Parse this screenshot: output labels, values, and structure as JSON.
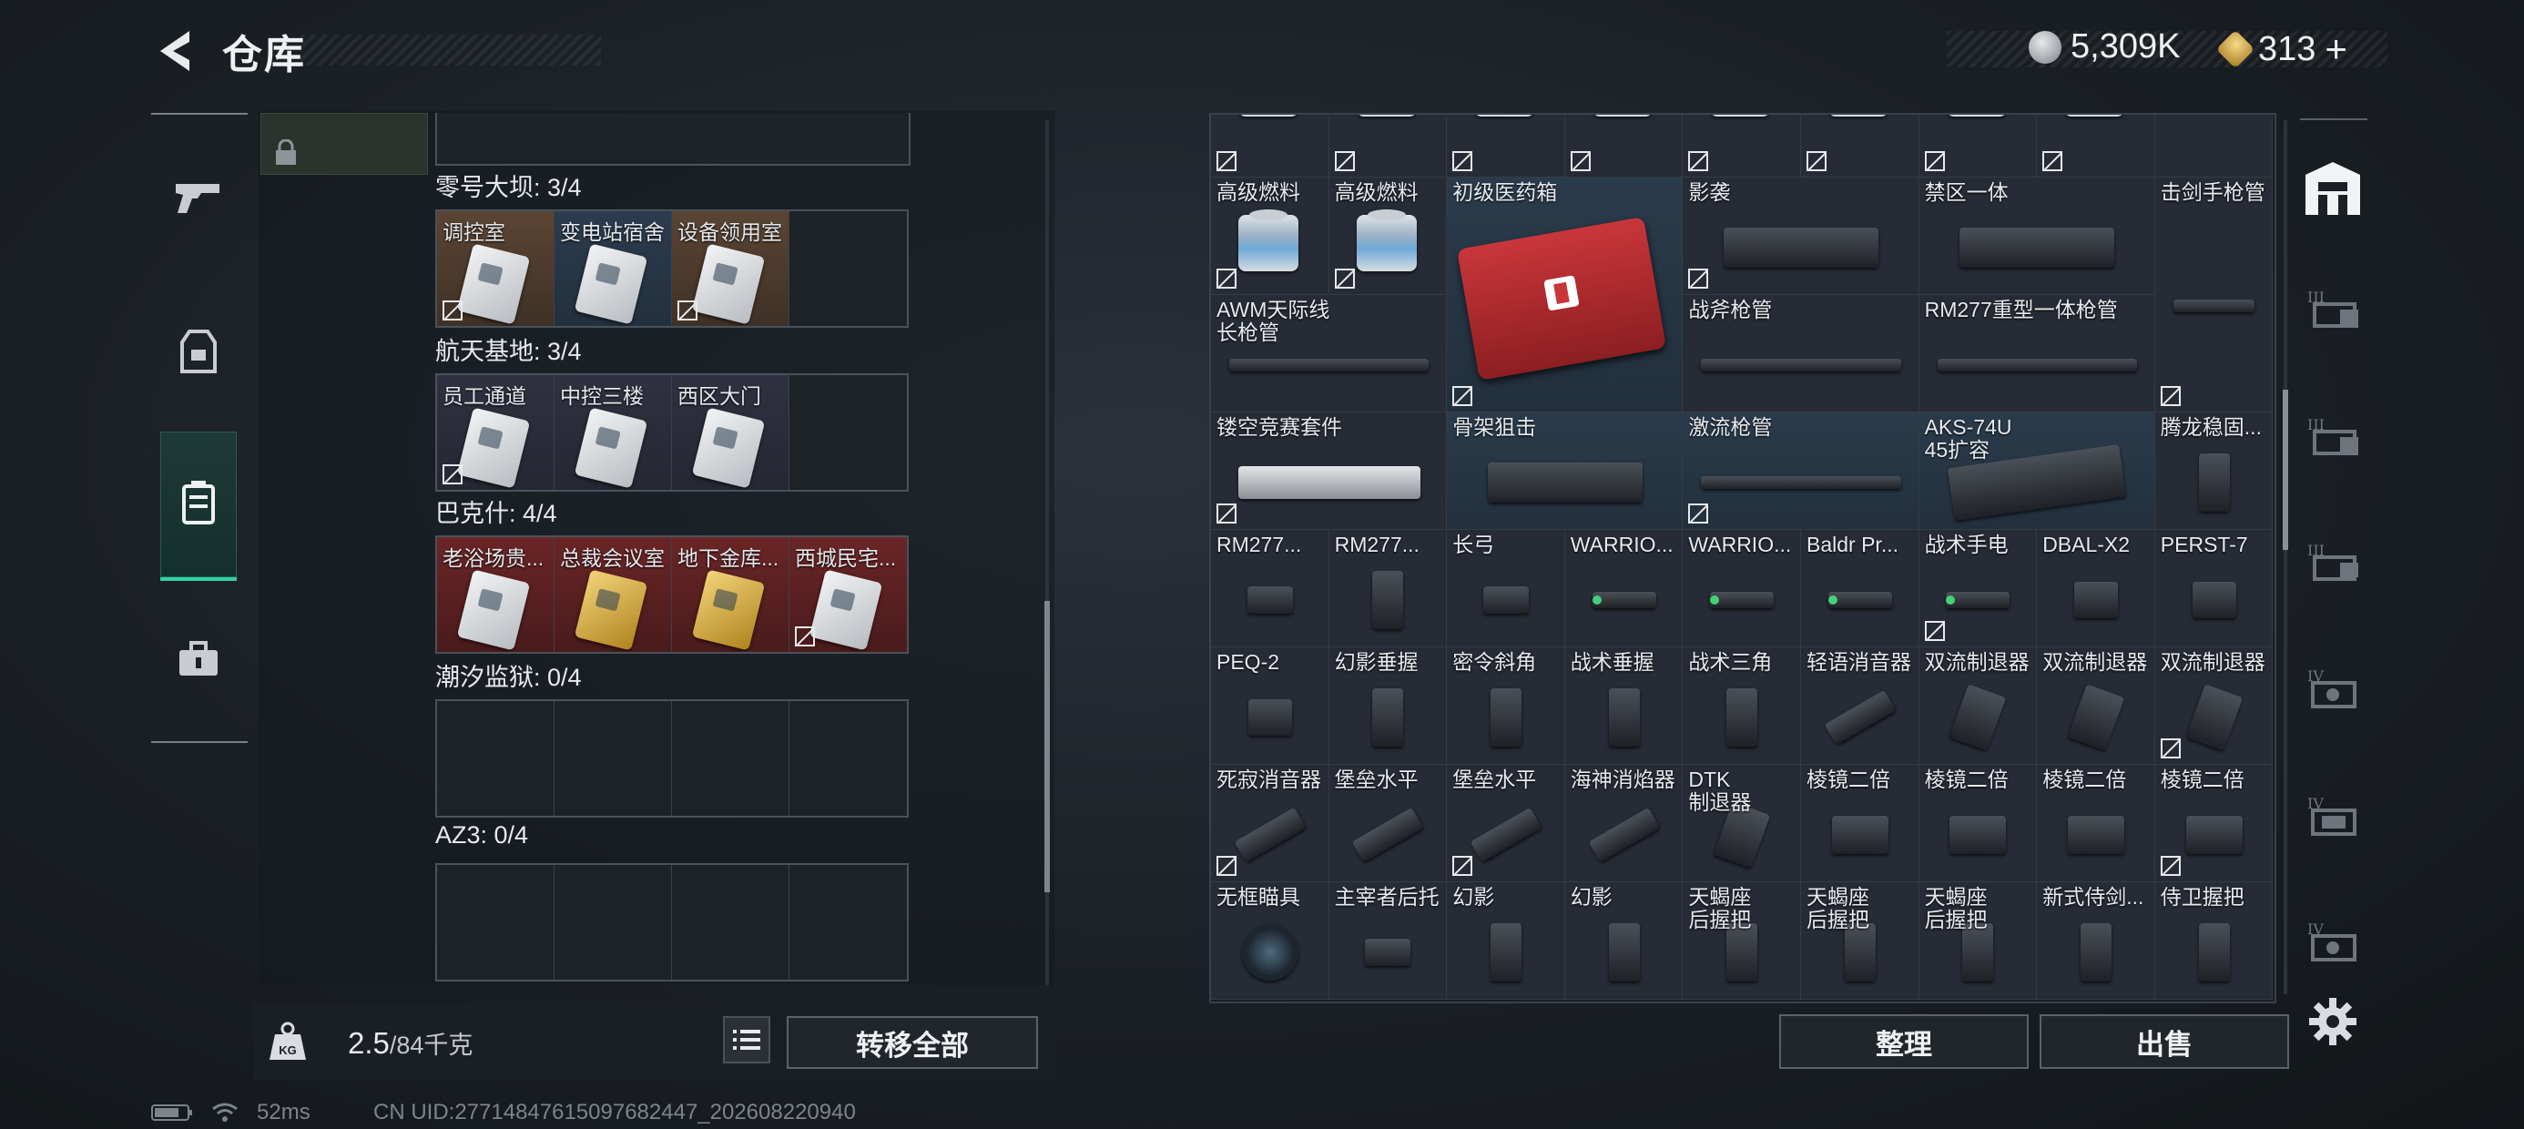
{
  "header": {
    "title": "仓库"
  },
  "currency": {
    "coins": "5,309K",
    "tickets": "313",
    "plus": "+"
  },
  "left": {
    "groups": [
      {
        "title": "零号大坝: 3/4",
        "cards": [
          {
            "label": "调控室",
            "bg": "brown",
            "kind": "silver",
            "unbound": true
          },
          {
            "label": "变电站宿舍",
            "bg": "blue",
            "kind": "silver",
            "unbound": false
          },
          {
            "label": "设备领用室",
            "bg": "brown",
            "kind": "silver",
            "unbound": true
          },
          {
            "label": "",
            "bg": "empty",
            "kind": "",
            "unbound": false
          }
        ]
      },
      {
        "title": "航天基地: 3/4",
        "cards": [
          {
            "label": "员工通道",
            "bg": "purple",
            "kind": "silver",
            "unbound": true
          },
          {
            "label": "中控三楼",
            "bg": "purple",
            "kind": "silver",
            "unbound": false
          },
          {
            "label": "西区大门",
            "bg": "purple",
            "kind": "silver",
            "unbound": false
          },
          {
            "label": "",
            "bg": "empty",
            "kind": "",
            "unbound": false
          }
        ]
      },
      {
        "title": "巴克什: 4/4",
        "cards": [
          {
            "label": "老浴场贵...",
            "bg": "red",
            "kind": "silver",
            "unbound": false
          },
          {
            "label": "总裁会议室",
            "bg": "red",
            "kind": "gold",
            "unbound": false
          },
          {
            "label": "地下金库...",
            "bg": "red",
            "kind": "gold",
            "unbound": false
          },
          {
            "label": "西城民宅...",
            "bg": "red",
            "kind": "silver",
            "unbound": true
          }
        ]
      },
      {
        "title": "潮汐监狱: 0/4",
        "cards": []
      },
      {
        "title": "AZ3: 0/4",
        "cards": []
      }
    ]
  },
  "weight": {
    "current": "2.5",
    "max": "/84千克"
  },
  "buttons": {
    "transfer_all": "转移全部",
    "sort": "整理",
    "sell": "出售"
  },
  "stash": {
    "top_row": [
      {
        "unbound": true
      },
      {
        "unbound": true
      },
      {
        "unbound": true
      },
      {
        "unbound": true
      },
      {
        "unbound": true
      },
      {
        "unbound": true
      },
      {
        "unbound": true
      },
      {
        "unbound": true
      },
      {
        "unbound": false
      }
    ],
    "items": [
      {
        "label": "高级燃料",
        "icon": "fuel",
        "unbound": true
      },
      {
        "label": "高级燃料",
        "icon": "fuel",
        "unbound": true
      },
      {
        "label": "初级医药箱",
        "icon": "medkit",
        "unbound": true
      },
      {
        "label": "影袭",
        "icon": "stock",
        "unbound": true
      },
      {
        "label": "禁区一体",
        "icon": "stock",
        "unbound": false
      },
      {
        "label": "击剑手枪管",
        "icon": "barrel",
        "unbound": true
      },
      {
        "label": "AWM天际线\n长枪管",
        "icon": "barrel",
        "unbound": false
      },
      {
        "label": "战斧枪管",
        "icon": "barrel",
        "unbound": false
      },
      {
        "label": "RM277重型一体枪管",
        "icon": "barrel",
        "unbound": false
      },
      {
        "label": "镂空竞赛套件",
        "icon": "slide",
        "unbound": true
      },
      {
        "label": "骨架狙击",
        "icon": "stock",
        "unbound": false
      },
      {
        "label": "激流枪管",
        "icon": "barrel",
        "unbound": true
      },
      {
        "label": "AKS-74U\n45扩容",
        "icon": "magazine",
        "unbound": false
      },
      {
        "label": "腾龙稳固...",
        "icon": "grip",
        "unbound": false
      },
      {
        "label": "RM277...",
        "icon": "part",
        "unbound": false
      },
      {
        "label": "RM277...",
        "icon": "grip",
        "unbound": false
      },
      {
        "label": "长弓",
        "icon": "part",
        "unbound": false
      },
      {
        "label": "WARRIO...",
        "icon": "light",
        "unbound": false
      },
      {
        "label": "WARRIO...",
        "icon": "light",
        "unbound": false
      },
      {
        "label": "Baldr Pr...",
        "icon": "light",
        "unbound": false
      },
      {
        "label": "战术手电",
        "icon": "light",
        "unbound": true
      },
      {
        "label": "DBAL-X2",
        "icon": "laser",
        "unbound": false
      },
      {
        "label": "PERST-7",
        "icon": "laser",
        "unbound": false
      },
      {
        "label": "PEQ-2",
        "icon": "laser",
        "unbound": false
      },
      {
        "label": "幻影垂握",
        "icon": "grip",
        "unbound": false
      },
      {
        "label": "密令斜角",
        "icon": "grip",
        "unbound": false
      },
      {
        "label": "战术垂握",
        "icon": "grip",
        "unbound": false
      },
      {
        "label": "战术三角",
        "icon": "grip",
        "unbound": false
      },
      {
        "label": "轻语消音器",
        "icon": "suppressor",
        "unbound": false
      },
      {
        "label": "双流制退器",
        "icon": "brake",
        "unbound": false
      },
      {
        "label": "双流制退器",
        "icon": "brake",
        "unbound": false
      },
      {
        "label": "双流制退器",
        "icon": "brake",
        "unbound": true
      },
      {
        "label": "死寂消音器",
        "icon": "suppressor",
        "unbound": true
      },
      {
        "label": "堡垒水平",
        "icon": "suppressor",
        "unbound": false
      },
      {
        "label": "堡垒水平",
        "icon": "suppressor",
        "unbound": true
      },
      {
        "label": "海神消焰器",
        "icon": "suppressor",
        "unbound": false
      },
      {
        "label": "DTK\n制退器",
        "icon": "brake",
        "unbound": false
      },
      {
        "label": "棱镜二倍",
        "icon": "scope",
        "unbound": false
      },
      {
        "label": "棱镜二倍",
        "icon": "scope",
        "unbound": false
      },
      {
        "label": "棱镜二倍",
        "icon": "scope",
        "unbound": false
      },
      {
        "label": "棱镜二倍",
        "icon": "scope",
        "unbound": true
      },
      {
        "label": "无框瞄具",
        "icon": "sight",
        "unbound": false
      },
      {
        "label": "主宰者后托",
        "icon": "part",
        "unbound": false
      },
      {
        "label": "幻影",
        "icon": "grip",
        "unbound": false
      },
      {
        "label": "幻影",
        "icon": "grip",
        "unbound": false
      },
      {
        "label": "天蝎座\n后握把",
        "icon": "grip",
        "unbound": false
      },
      {
        "label": "天蝎座\n后握把",
        "icon": "grip",
        "unbound": false
      },
      {
        "label": "天蝎座\n后握把",
        "icon": "grip",
        "unbound": false
      },
      {
        "label": "新式侍剑...",
        "icon": "grip",
        "unbound": false
      },
      {
        "label": "侍卫握把",
        "icon": "grip",
        "unbound": false
      }
    ]
  },
  "status": {
    "ping": "52ms",
    "uid": "CN UID:27714847615097682447_202608220940"
  },
  "colors": {
    "accent": "#2fd3a4",
    "red_card": "#6a2526",
    "gold": "#f3d37a"
  }
}
